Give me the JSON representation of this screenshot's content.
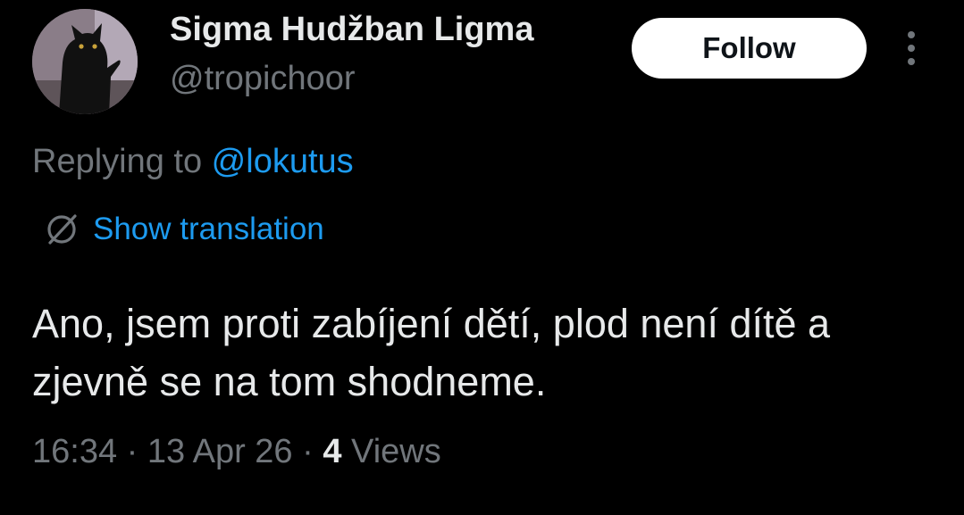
{
  "author": {
    "display_name": "Sigma Hudžban Ligma",
    "handle": "@tropichoor",
    "avatar_icon": "black-cat-avatar"
  },
  "actions": {
    "follow_label": "Follow",
    "more_icon": "more-vertical-icon"
  },
  "reply": {
    "prefix": "Replying to ",
    "mention": "@lokutus"
  },
  "translation": {
    "icon": "globe-translate-icon",
    "label": "Show translation"
  },
  "tweet": {
    "text": "Ano, jsem proti zabíjení dětí, plod není dítě a zjevně se na tom shodneme."
  },
  "meta": {
    "time": "16:34",
    "separator": " · ",
    "date": "13 Apr 26",
    "views_count": "4",
    "views_label": "Views"
  },
  "colors": {
    "background": "#000000",
    "text_primary": "#e7e9ea",
    "text_secondary": "#71767b",
    "link": "#1d9bf0",
    "follow_bg": "#ffffff",
    "follow_text": "#0f1419"
  }
}
